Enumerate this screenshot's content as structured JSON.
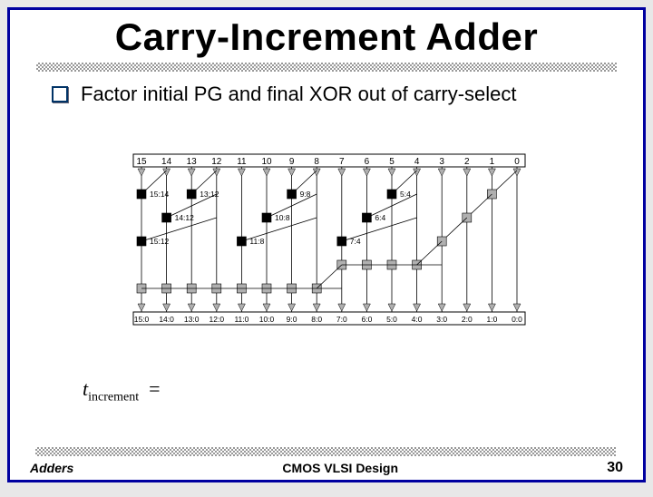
{
  "title": "Carry-Increment Adder",
  "bullet": "Factor initial PG and final XOR out of carry-select",
  "equation": {
    "var": "t",
    "sub": "increment",
    "eq": "="
  },
  "footer": {
    "left": "Adders",
    "center": "CMOS VLSI Design",
    "page": "30"
  },
  "chart_data": {
    "type": "prefix-adder-diagram",
    "title": "Carry-Increment Adder prefix graph",
    "bit_count": 16,
    "columns": [
      15,
      14,
      13,
      12,
      11,
      10,
      9,
      8,
      7,
      6,
      5,
      4,
      3,
      2,
      1,
      0
    ],
    "row_count": 5,
    "black_cells": [
      {
        "row": 1,
        "col": 15,
        "label": "15:14"
      },
      {
        "row": 1,
        "col": 13,
        "label": "13:12"
      },
      {
        "row": 1,
        "col": 9,
        "label": "9:8"
      },
      {
        "row": 1,
        "col": 5,
        "label": "5:4"
      },
      {
        "row": 2,
        "col": 14,
        "label": "14:12"
      },
      {
        "row": 2,
        "col": 10,
        "label": "10:8"
      },
      {
        "row": 2,
        "col": 6,
        "label": "6:4"
      },
      {
        "row": 3,
        "col": 15,
        "label": "15:12"
      },
      {
        "row": 3,
        "col": 11,
        "label": "11:8"
      },
      {
        "row": 3,
        "col": 7,
        "label": "7:4"
      }
    ],
    "gray_cells": [
      {
        "row": 1,
        "col": 1
      },
      {
        "row": 2,
        "col": 2
      },
      {
        "row": 3,
        "col": 3
      },
      {
        "row": 4,
        "col": 4
      },
      {
        "row": 4,
        "col": 5
      },
      {
        "row": 4,
        "col": 6
      },
      {
        "row": 4,
        "col": 7
      },
      {
        "row": 5,
        "col": 8
      },
      {
        "row": 5,
        "col": 9
      },
      {
        "row": 5,
        "col": 10
      },
      {
        "row": 5,
        "col": 11
      },
      {
        "row": 5,
        "col": 12
      },
      {
        "row": 5,
        "col": 13
      },
      {
        "row": 5,
        "col": 14
      },
      {
        "row": 5,
        "col": 15
      }
    ],
    "output_labels": [
      "15:0",
      "14:0",
      "13:0",
      "12:0",
      "11:0",
      "10:0",
      "9:0",
      "8:0",
      "7:0",
      "6:0",
      "5:0",
      "4:0",
      "3:0",
      "2:0",
      "1:0",
      "0:0"
    ]
  }
}
